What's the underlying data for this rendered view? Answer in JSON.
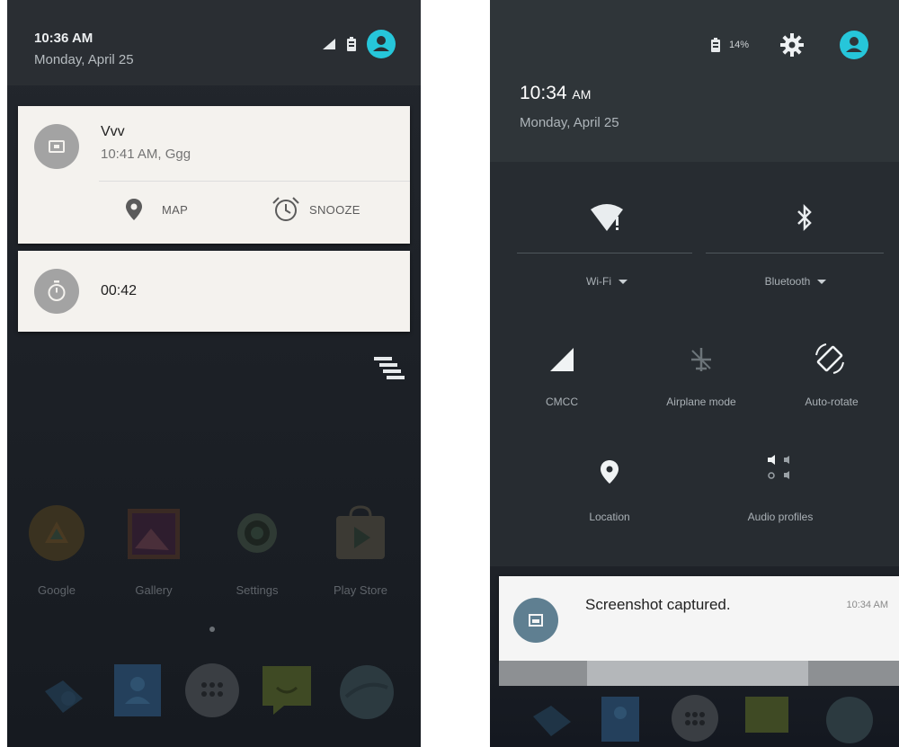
{
  "left_screen": {
    "status": {
      "time": "10:36 AM",
      "date": "Monday, April 25"
    },
    "alarm_notification": {
      "title": "Vvv",
      "subtitle": "10:41 AM, Ggg",
      "actions": [
        {
          "label": "MAP",
          "icon": "map-pin-icon"
        },
        {
          "label": "SNOOZE",
          "icon": "alarm-clock-icon"
        }
      ]
    },
    "timer_notification": {
      "value": "00:42",
      "icon": "stopwatch-icon"
    },
    "home_apps": [
      {
        "label": "Google",
        "icon": "google-app-icon"
      },
      {
        "label": "Gallery",
        "icon": "gallery-icon"
      },
      {
        "label": "Settings",
        "icon": "settings-icon"
      },
      {
        "label": "Play Store",
        "icon": "play-store-icon"
      }
    ],
    "dock": [
      "phone-icon",
      "contacts-icon",
      "app-drawer-icon",
      "messaging-icon",
      "browser-icon"
    ]
  },
  "right_screen": {
    "status": {
      "battery_text": "14%"
    },
    "header": {
      "time": "10:34",
      "time_suffix": "AM",
      "date": "Monday, April 25"
    },
    "quick_settings": {
      "wifi_label": "Wi-Fi",
      "bluetooth_label": "Bluetooth",
      "tiles": [
        {
          "label": "CMCC",
          "icon": "cellular-signal-icon"
        },
        {
          "label": "Airplane mode",
          "icon": "airplane-icon"
        },
        {
          "label": "Auto-rotate",
          "icon": "auto-rotate-icon"
        },
        {
          "label": "Location",
          "icon": "location-icon"
        },
        {
          "label": "Audio profiles",
          "icon": "audio-profiles-icon"
        }
      ]
    },
    "screenshot_notification": {
      "title": "Screenshot captured.",
      "time": "10:34 AM",
      "icon": "image-icon"
    }
  },
  "colors": {
    "accent": "#26c6da",
    "card": "#f4f2ee",
    "panel": "#272c31",
    "header": "#2f3539"
  }
}
